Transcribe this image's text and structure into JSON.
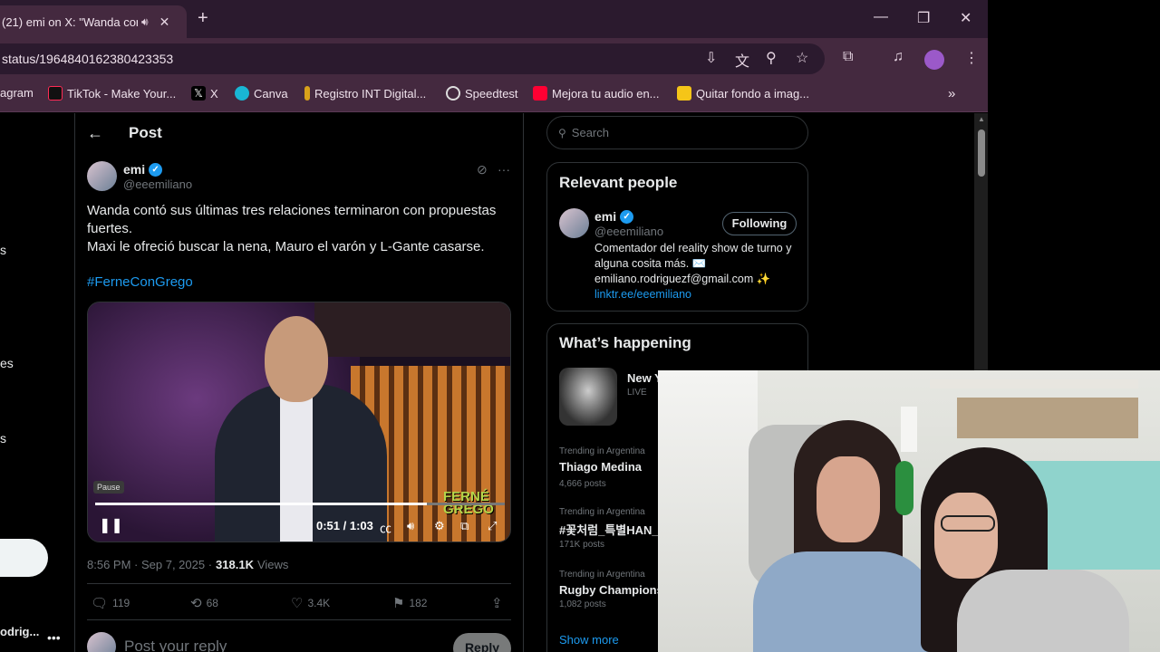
{
  "browser": {
    "tab_title": "(21) emi on X: \"Wanda cont",
    "url": "status/1964840162380423353",
    "bookmarks": [
      {
        "label": "agram",
        "color": "#e1306c"
      },
      {
        "label": "TikTok - Make Your...",
        "color": "#111111"
      },
      {
        "label": "X",
        "color": "#000000"
      },
      {
        "label": "Canva",
        "color": "#19b6d4"
      },
      {
        "label": "Registro INT Digital...",
        "color": "#d8a11a"
      },
      {
        "label": "Speedtest",
        "color": "#2b2b2b"
      },
      {
        "label": "Mejora tu audio en...",
        "color": "#ff0033"
      },
      {
        "label": "Quitar fondo a imag...",
        "color": "#f5c518"
      }
    ]
  },
  "leftnav": {
    "frag1": "s",
    "frag2": "es",
    "frag3": "s",
    "user": "odrig..."
  },
  "post": {
    "header": "Post",
    "author_name": "emi",
    "author_handle": "@eeemiliano",
    "text_line1": "Wanda contó sus últimas tres relaciones terminaron con propuestas",
    "text_line2": "fuertes.",
    "text_line3": "Maxi le ofreció buscar la nena, Mauro el varón y L-Gante casarse.",
    "hashtag": "#FerneConGrego",
    "video": {
      "tooltip": "Pause",
      "time": "0:51 / 1:03",
      "progress": 0.81,
      "brand_line1": "FERNÉ",
      "brand_line2": "GREGO"
    },
    "meta_time": "8:56 PM · Sep 7, 2025 ·",
    "views_count": "318.1K",
    "views_label": "Views",
    "replies": "119",
    "reposts": "68",
    "likes": "3.4K",
    "bookmarks": "182",
    "reply_placeholder": "Post your reply",
    "reply_button": "Reply"
  },
  "sidebar": {
    "search_placeholder": "Search",
    "relevant_title": "Relevant people",
    "person_name": "emi",
    "person_handle": "@eeemiliano",
    "follow_label": "Following",
    "bio": "Comentador del reality show de turno y alguna cosita más. ✉️ emiliano.rodriguezf@gmail.com ✨",
    "bio_link": "linktr.ee/eeemiliano",
    "happening_title": "What’s happening",
    "live_name": "New Y",
    "live_tag": "LIVE",
    "trends": [
      {
        "context": "Trending in Argentina",
        "name": "Thiago Medina",
        "count": "4,666 posts"
      },
      {
        "context": "Trending in Argentina",
        "name": "#꽃처럼_특별HAN_",
        "count": "171K posts"
      },
      {
        "context": "Trending in Argentina",
        "name": "Rugby Champions",
        "count": "1,082 posts"
      }
    ],
    "show_more": "Show more"
  }
}
